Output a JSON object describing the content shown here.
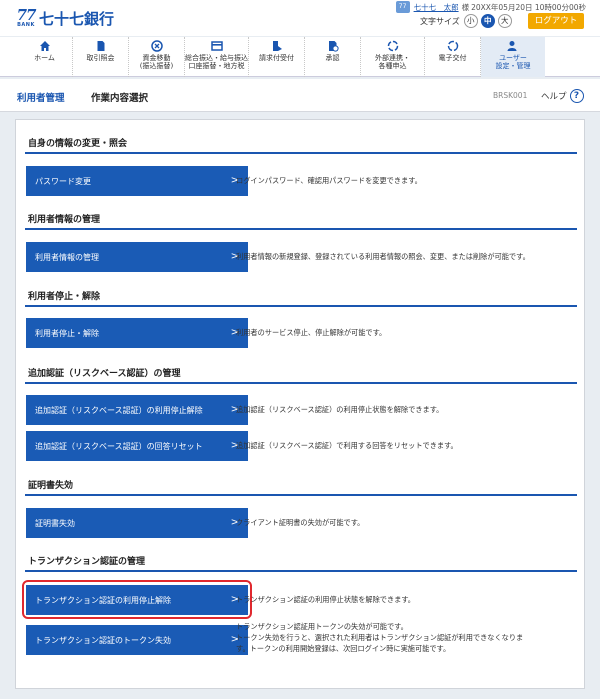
{
  "header": {
    "logo_mark": "77",
    "logo_sub": "BANK",
    "bank_name": "七十七銀行",
    "user_badge": "77",
    "user_name": "七十七　太郎",
    "user_suffix": "様",
    "user_time": "20XX年05月20日 10時00分00秒",
    "text_size_label": "文字サイズ",
    "size_small": "小",
    "size_medium": "中",
    "size_large": "大",
    "logout_label": "ログアウト"
  },
  "nav": {
    "items": [
      {
        "label": "ホーム",
        "icon": "home-icon"
      },
      {
        "label": "取引照会",
        "icon": "document-icon"
      },
      {
        "label": "資金移動\n(振込振替)",
        "icon": "transfer-icon"
      },
      {
        "label": "総合振込・給与振込\n口座振替・地方税",
        "icon": "payment-icon"
      },
      {
        "label": "請求付受付",
        "icon": "request-icon"
      },
      {
        "label": "承認",
        "icon": "approve-icon"
      },
      {
        "label": "外部連携・\n各種申込",
        "icon": "link-icon"
      },
      {
        "label": "電子交付",
        "icon": "delivery-icon"
      },
      {
        "label": "ユーザー\n設定・管理",
        "icon": "user-settings-icon"
      }
    ]
  },
  "breadcrumb": {
    "level1": "利用者管理",
    "level2": "作業内容選択",
    "screen_id": "BRSK001",
    "help_label": "ヘルプ",
    "help_icon": "?"
  },
  "sections": [
    {
      "title": "自身の情報の変更・照会",
      "actions": [
        {
          "label": "パスワード変更",
          "desc": "ログインパスワード、確認用パスワードを変更できます。"
        }
      ]
    },
    {
      "title": "利用者情報の管理",
      "actions": [
        {
          "label": "利用者情報の管理",
          "desc": "利用者情報の新規登録、登録されている利用者情報の照会、変更、または削除が可能です。"
        }
      ]
    },
    {
      "title": "利用者停止・解除",
      "actions": [
        {
          "label": "利用者停止・解除",
          "desc": "利用者のサービス停止、停止解除が可能です。"
        }
      ]
    },
    {
      "title": "追加認証（リスクベース認証）の管理",
      "actions": [
        {
          "label": "追加認証（リスクベース認証）の利用停止解除",
          "desc": "追加認証（リスクベース認証）の利用停止状態を解除できます。"
        },
        {
          "label": "追加認証（リスクベース認証）の回答リセット",
          "desc": "追加認証（リスクベース認証）で利用する回答をリセットできます。"
        }
      ]
    },
    {
      "title": "証明書失効",
      "actions": [
        {
          "label": "証明書失効",
          "desc": "クライアント証明書の失効が可能です。"
        }
      ]
    },
    {
      "title": "トランザクション認証の管理",
      "actions": [
        {
          "label": "トランザクション認証の利用停止解除",
          "desc": "トランザクション認証の利用停止状態を解除できます。"
        },
        {
          "label": "トランザクション認証のトークン失効",
          "desc1": "トランザクション認証用トークンの失効が可能です。",
          "desc2": "トークン失効を行うと、選択された利用者はトランザクション認証が利用できなくなりま",
          "desc3": "す。トークンの利用開始登録は、次回ログイン時に実施可能です。"
        }
      ]
    }
  ],
  "chevron": ">",
  "colors": {
    "primary": "#1a5bb5",
    "accent": "#f2a800",
    "highlight": "#e0282e"
  }
}
